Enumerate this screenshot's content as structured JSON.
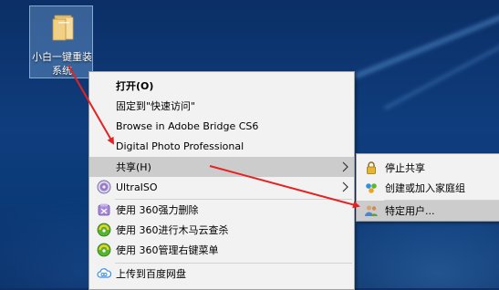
{
  "desktop": {
    "icon_label": "小白一键重装系统"
  },
  "context_menu": {
    "items": [
      {
        "label": "打开(O)"
      },
      {
        "label": "固定到\"快速访问\""
      },
      {
        "label": "Browse in Adobe Bridge CS6"
      },
      {
        "label": "Digital Photo Professional"
      },
      {
        "label": "共享(H)"
      },
      {
        "label": "UltraISO"
      },
      {
        "label": "使用 360强力删除"
      },
      {
        "label": "使用 360进行木马云查杀"
      },
      {
        "label": "使用 360管理右键菜单"
      },
      {
        "label": "上传到百度网盘"
      }
    ]
  },
  "share_submenu": {
    "items": [
      {
        "label": "停止共享"
      },
      {
        "label": "创建或加入家庭组"
      },
      {
        "label": "特定用户..."
      }
    ]
  },
  "colors": {
    "menu_bg": "#f2f2f2",
    "highlight": "#cccccc",
    "annotation": "#e52222",
    "desktop_bg": "#0f3d7d"
  },
  "icons": [
    "folder-icon",
    "ultraiso-icon",
    "360-delete-icon",
    "360-scan-icon",
    "360-menu-icon",
    "baidu-cloud-icon",
    "lock-icon",
    "homegroup-icon",
    "users-icon",
    "submenu-arrow-icon"
  ]
}
